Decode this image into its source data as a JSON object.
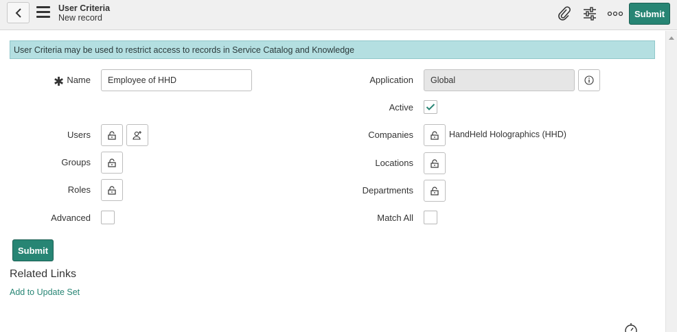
{
  "header": {
    "title": "User Criteria",
    "subtitle": "New record",
    "submit_label": "Submit",
    "icons": [
      "chevron-left-icon",
      "hamburger-icon",
      "paperclip-icon",
      "sliders-icon",
      "more-icon"
    ]
  },
  "banner": {
    "text": "User Criteria may be used to restrict access to records in Service Catalog and Knowledge"
  },
  "form": {
    "name": {
      "label": "Name",
      "value": "Employee of HHD",
      "required": true
    },
    "application": {
      "label": "Application",
      "value": "Global"
    },
    "active": {
      "label": "Active",
      "checked": true
    },
    "users": {
      "label": "Users"
    },
    "groups": {
      "label": "Groups"
    },
    "roles": {
      "label": "Roles"
    },
    "advanced": {
      "label": "Advanced",
      "checked": false
    },
    "companies": {
      "label": "Companies",
      "value": "HandHeld Holographics (HHD)"
    },
    "locations": {
      "label": "Locations"
    },
    "departments": {
      "label": "Departments"
    },
    "match_all": {
      "label": "Match All",
      "checked": false
    }
  },
  "footer": {
    "submit_label": "Submit",
    "related_links_title": "Related Links",
    "related_links": [
      {
        "label": "Add to Update Set"
      }
    ]
  },
  "colors": {
    "accent": "#278574",
    "banner": "#b4dfe1",
    "header_bg": "#f0f0f0"
  }
}
